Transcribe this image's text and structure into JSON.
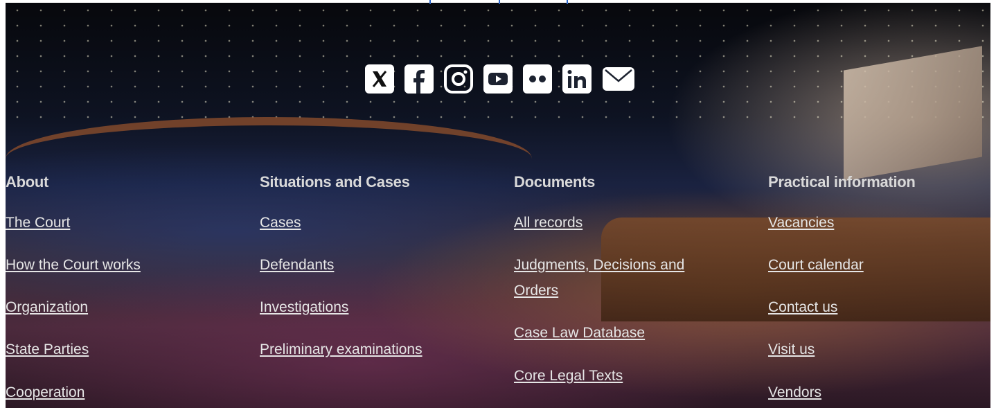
{
  "social": [
    {
      "name": "x-icon",
      "label": "X"
    },
    {
      "name": "facebook-icon",
      "label": "Facebook"
    },
    {
      "name": "instagram-icon",
      "label": "Instagram"
    },
    {
      "name": "youtube-icon",
      "label": "YouTube"
    },
    {
      "name": "flickr-icon",
      "label": "Flickr"
    },
    {
      "name": "linkedin-icon",
      "label": "LinkedIn"
    },
    {
      "name": "email-icon",
      "label": "Email"
    }
  ],
  "footer": {
    "about": {
      "heading": "About",
      "links": [
        "The Court",
        "How the Court works",
        "Organization",
        "State Parties",
        "Cooperation"
      ]
    },
    "situations": {
      "heading": "Situations and Cases",
      "links": [
        "Cases",
        "Defendants",
        "Investigations",
        "Preliminary examinations"
      ]
    },
    "documents": {
      "heading": "Documents",
      "links": [
        "All records",
        "Judgments, Decisions and Orders",
        "Case Law Database",
        "Core Legal Texts"
      ]
    },
    "practical": {
      "heading": "Practical information",
      "links": [
        "Vacancies",
        "Court calendar",
        "Contact us",
        "Visit us",
        "Vendors"
      ]
    }
  },
  "colors": {
    "icon_fill": "#ffffff",
    "link": "#e6e6e6",
    "heading": "#d9d9d9",
    "accent_rule": "#2a64c8"
  }
}
